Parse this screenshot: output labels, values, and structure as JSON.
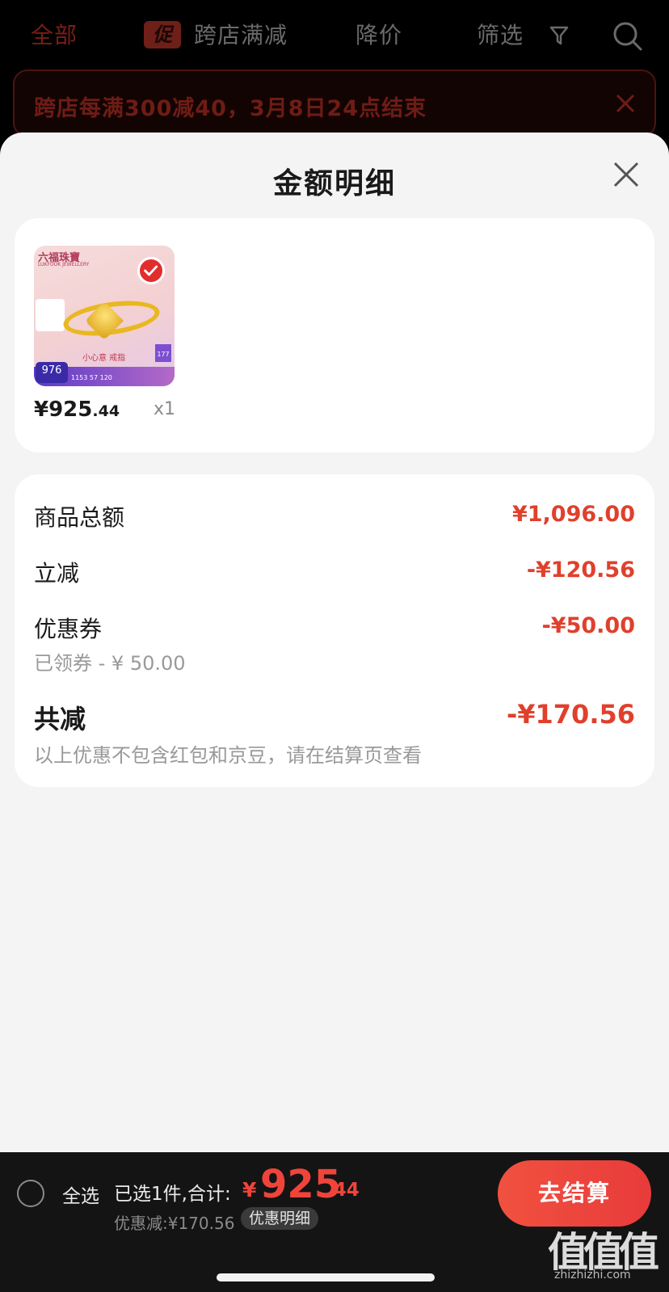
{
  "topnav": {
    "tab_all": "全部",
    "promo_tag": "促",
    "tab_cross_store": "跨店满减",
    "tab_price_drop": "降价",
    "tab_filter": "筛选",
    "filter_icon": "filter-funnel-icon",
    "search_icon": "search-icon"
  },
  "banner": {
    "text": "跨店每满300减40，3月8日24点结束",
    "close_icon": "close-icon"
  },
  "sheet": {
    "title": "金额明细",
    "close_icon": "close-icon"
  },
  "product": {
    "brand": "六福珠寶",
    "brand_sub": "LUKFOOK JEWELLERY",
    "slogan": "小心意 戒指",
    "badge_price": "976",
    "badge_tag": "177",
    "bar_nums": "1153 57 120",
    "price_int": "¥925",
    "price_dec": ".44",
    "qty": "x1",
    "check_icon": "check-circle-icon"
  },
  "summary": {
    "goods_total_label": "商品总额",
    "goods_total_value": "¥1,096.00",
    "instant_discount_label": "立减",
    "instant_discount_value": "-¥120.56",
    "coupon_label": "优惠券",
    "coupon_value": "-¥50.00",
    "coupon_sub": "已领券 - ¥ 50.00",
    "total_discount_label": "共减",
    "total_discount_value": "-¥170.56",
    "note": "以上优惠不包含红包和京豆，请在结算页查看"
  },
  "bottombar": {
    "select_all": "全选",
    "selected_text": "已选1件,合计:",
    "total_currency": "¥",
    "total_int": "925",
    "total_dec": ".44",
    "discount_text": "优惠减:¥170.56",
    "discount_detail": "优惠明细",
    "checkout": "去结算",
    "watermark_big": "值值值",
    "watermark_small": "zhizhizhi.com"
  },
  "colors": {
    "accent_red": "#e0402c",
    "checkout_red": "#ef4a3d",
    "dim_overlay": "#000000"
  }
}
